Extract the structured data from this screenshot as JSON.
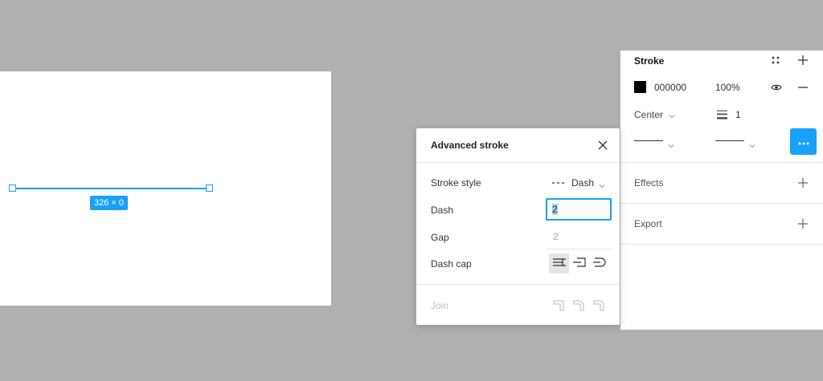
{
  "canvas": {
    "dimension_label": "326 × 0",
    "selection_color": "#18a0fb"
  },
  "panel": {
    "stroke": {
      "title": "Stroke",
      "color_hex": "000000",
      "opacity": "100%",
      "align": "Center",
      "weight": "1"
    },
    "effects": {
      "title": "Effects"
    },
    "export": {
      "title": "Export"
    }
  },
  "dialog": {
    "title": "Advanced stroke",
    "stroke_style": {
      "label": "Stroke style",
      "value": "Dash"
    },
    "dash": {
      "label": "Dash",
      "value": "2"
    },
    "gap": {
      "label": "Gap",
      "value": "2"
    },
    "dash_cap": {
      "label": "Dash cap"
    },
    "join": {
      "label": "Join"
    }
  },
  "colors": {
    "accent": "#18a0fb",
    "canvas_bg": "#b0b0b0"
  }
}
